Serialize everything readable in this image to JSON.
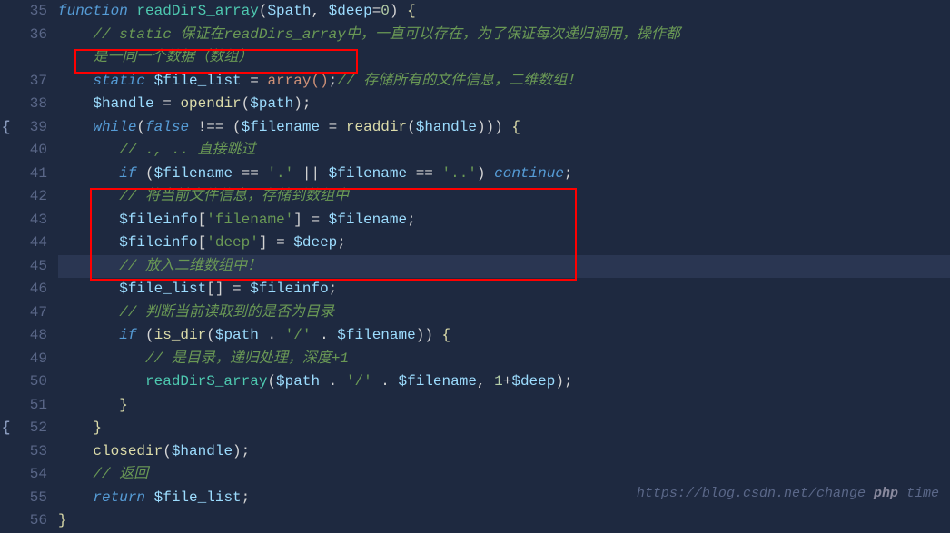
{
  "lines": [
    {
      "num": "35",
      "fold": "",
      "code": [
        {
          "cls": "k-keyword",
          "text": "function"
        },
        {
          "cls": "k-op",
          "text": " "
        },
        {
          "cls": "k-funcname",
          "text": "readDirS_array"
        },
        {
          "cls": "k-paren",
          "text": "("
        },
        {
          "cls": "k-var",
          "text": "$path"
        },
        {
          "cls": "k-op",
          "text": ", "
        },
        {
          "cls": "k-var",
          "text": "$deep"
        },
        {
          "cls": "k-op",
          "text": "="
        },
        {
          "cls": "k-number",
          "text": "0"
        },
        {
          "cls": "k-paren",
          "text": ") "
        },
        {
          "cls": "k-brace",
          "text": "{"
        }
      ],
      "indent": 0
    },
    {
      "num": "36",
      "fold": "",
      "code": [
        {
          "cls": "k-comment",
          "text": "// static 保证在readDirs_array中，一直可以存在，为了保证每次递归调用，操作都是一同一个数据（数组）"
        }
      ],
      "indent": 1,
      "wrap": true
    },
    {
      "num": "37",
      "fold": "",
      "code": [
        {
          "cls": "k-keyword",
          "text": "static"
        },
        {
          "cls": "k-op",
          "text": " "
        },
        {
          "cls": "k-var",
          "text": "$file_list"
        },
        {
          "cls": "k-op",
          "text": " = "
        },
        {
          "cls": "k-orange",
          "text": "array()"
        },
        {
          "cls": "k-op",
          "text": ";"
        },
        {
          "cls": "k-comment",
          "text": "// 存储所有的文件信息，二维数组！"
        }
      ],
      "indent": 1
    },
    {
      "num": "38",
      "fold": "",
      "code": [
        {
          "cls": "k-var",
          "text": "$handle"
        },
        {
          "cls": "k-op",
          "text": " = "
        },
        {
          "cls": "k-function",
          "text": "opendir"
        },
        {
          "cls": "k-paren",
          "text": "("
        },
        {
          "cls": "k-var",
          "text": "$path"
        },
        {
          "cls": "k-paren",
          "text": ");"
        }
      ],
      "indent": 1
    },
    {
      "num": "39",
      "fold": "{",
      "code": [
        {
          "cls": "k-keyword",
          "text": "while"
        },
        {
          "cls": "k-paren",
          "text": "("
        },
        {
          "cls": "k-keyword",
          "text": "false"
        },
        {
          "cls": "k-op",
          "text": " !== ("
        },
        {
          "cls": "k-var",
          "text": "$filename"
        },
        {
          "cls": "k-op",
          "text": " = "
        },
        {
          "cls": "k-function",
          "text": "readdir"
        },
        {
          "cls": "k-paren",
          "text": "("
        },
        {
          "cls": "k-var",
          "text": "$handle"
        },
        {
          "cls": "k-paren",
          "text": "))) "
        },
        {
          "cls": "k-brace",
          "text": "{"
        }
      ],
      "indent": 1
    },
    {
      "num": "40",
      "fold": "",
      "code": [
        {
          "cls": "k-comment",
          "text": "// ., .. 直接跳过"
        }
      ],
      "indent": 2
    },
    {
      "num": "41",
      "fold": "",
      "code": [
        {
          "cls": "k-keyword",
          "text": "if"
        },
        {
          "cls": "k-op",
          "text": " ("
        },
        {
          "cls": "k-var",
          "text": "$filename"
        },
        {
          "cls": "k-op",
          "text": " == "
        },
        {
          "cls": "k-str2",
          "text": "'.'"
        },
        {
          "cls": "k-op",
          "text": " || "
        },
        {
          "cls": "k-var",
          "text": "$filename"
        },
        {
          "cls": "k-op",
          "text": " == "
        },
        {
          "cls": "k-str2",
          "text": "'..'"
        },
        {
          "cls": "k-op",
          "text": ") "
        },
        {
          "cls": "k-keyword",
          "text": "continue"
        },
        {
          "cls": "k-op",
          "text": ";"
        }
      ],
      "indent": 2
    },
    {
      "num": "42",
      "fold": "",
      "code": [
        {
          "cls": "k-comment",
          "text": "// 将当前文件信息，存储到数组中"
        }
      ],
      "indent": 2
    },
    {
      "num": "43",
      "fold": "",
      "code": [
        {
          "cls": "k-var",
          "text": "$fileinfo"
        },
        {
          "cls": "k-op",
          "text": "["
        },
        {
          "cls": "k-str2",
          "text": "'filename'"
        },
        {
          "cls": "k-op",
          "text": "] = "
        },
        {
          "cls": "k-var",
          "text": "$filename"
        },
        {
          "cls": "k-op",
          "text": ";"
        }
      ],
      "indent": 2
    },
    {
      "num": "44",
      "fold": "",
      "code": [
        {
          "cls": "k-var",
          "text": "$fileinfo"
        },
        {
          "cls": "k-op",
          "text": "["
        },
        {
          "cls": "k-str2",
          "text": "'deep'"
        },
        {
          "cls": "k-op",
          "text": "] = "
        },
        {
          "cls": "k-var",
          "text": "$deep"
        },
        {
          "cls": "k-op",
          "text": ";"
        }
      ],
      "indent": 2
    },
    {
      "num": "45",
      "fold": "",
      "code": [
        {
          "cls": "k-comment",
          "text": "// 放入二维数组中！"
        }
      ],
      "indent": 2,
      "highlight": true
    },
    {
      "num": "46",
      "fold": "",
      "code": [
        {
          "cls": "k-var",
          "text": "$file_list"
        },
        {
          "cls": "k-op",
          "text": "[] = "
        },
        {
          "cls": "k-var",
          "text": "$fileinfo"
        },
        {
          "cls": "k-op",
          "text": ";"
        }
      ],
      "indent": 2
    },
    {
      "num": "47",
      "fold": "",
      "code": [
        {
          "cls": "k-comment",
          "text": "// 判断当前读取到的是否为目录"
        }
      ],
      "indent": 2
    },
    {
      "num": "48",
      "fold": "",
      "code": [
        {
          "cls": "k-keyword",
          "text": "if"
        },
        {
          "cls": "k-op",
          "text": " ("
        },
        {
          "cls": "k-function",
          "text": "is_dir"
        },
        {
          "cls": "k-paren",
          "text": "("
        },
        {
          "cls": "k-var",
          "text": "$path"
        },
        {
          "cls": "k-op",
          "text": " . "
        },
        {
          "cls": "k-str2",
          "text": "'/'"
        },
        {
          "cls": "k-op",
          "text": " . "
        },
        {
          "cls": "k-var",
          "text": "$filename"
        },
        {
          "cls": "k-paren",
          "text": ")) "
        },
        {
          "cls": "k-brace",
          "text": "{"
        }
      ],
      "indent": 2
    },
    {
      "num": "49",
      "fold": "",
      "code": [
        {
          "cls": "k-comment",
          "text": "// 是目录，递归处理，深度+1"
        }
      ],
      "indent": 3
    },
    {
      "num": "50",
      "fold": "",
      "code": [
        {
          "cls": "k-funcname",
          "text": "readDirS_array"
        },
        {
          "cls": "k-paren",
          "text": "("
        },
        {
          "cls": "k-var",
          "text": "$path"
        },
        {
          "cls": "k-op",
          "text": " . "
        },
        {
          "cls": "k-str2",
          "text": "'/'"
        },
        {
          "cls": "k-op",
          "text": " . "
        },
        {
          "cls": "k-var",
          "text": "$filename"
        },
        {
          "cls": "k-op",
          "text": ", "
        },
        {
          "cls": "k-number",
          "text": "1"
        },
        {
          "cls": "k-op",
          "text": "+"
        },
        {
          "cls": "k-var",
          "text": "$deep"
        },
        {
          "cls": "k-paren",
          "text": ");"
        }
      ],
      "indent": 3
    },
    {
      "num": "51",
      "fold": "",
      "code": [
        {
          "cls": "k-brace",
          "text": "}"
        }
      ],
      "indent": 2
    },
    {
      "num": "52",
      "fold": "{",
      "code": [
        {
          "cls": "k-brace",
          "text": "}"
        }
      ],
      "indent": 1
    },
    {
      "num": "53",
      "fold": "",
      "code": [
        {
          "cls": "k-function",
          "text": "closedir"
        },
        {
          "cls": "k-paren",
          "text": "("
        },
        {
          "cls": "k-var",
          "text": "$handle"
        },
        {
          "cls": "k-paren",
          "text": ");"
        }
      ],
      "indent": 1
    },
    {
      "num": "54",
      "fold": "",
      "code": [
        {
          "cls": "k-comment",
          "text": "// 返回"
        }
      ],
      "indent": 1
    },
    {
      "num": "55",
      "fold": "",
      "code": [
        {
          "cls": "k-keyword",
          "text": "return"
        },
        {
          "cls": "k-op",
          "text": " "
        },
        {
          "cls": "k-var",
          "text": "$file_list"
        },
        {
          "cls": "k-op",
          "text": ";"
        }
      ],
      "indent": 1
    },
    {
      "num": "56",
      "fold": "",
      "code": [
        {
          "cls": "k-brace",
          "text": "}"
        }
      ],
      "indent": 0
    }
  ],
  "watermark": {
    "url": "https://blog.csdn.net/change_",
    "badge": "php",
    "suffix": "_time"
  }
}
